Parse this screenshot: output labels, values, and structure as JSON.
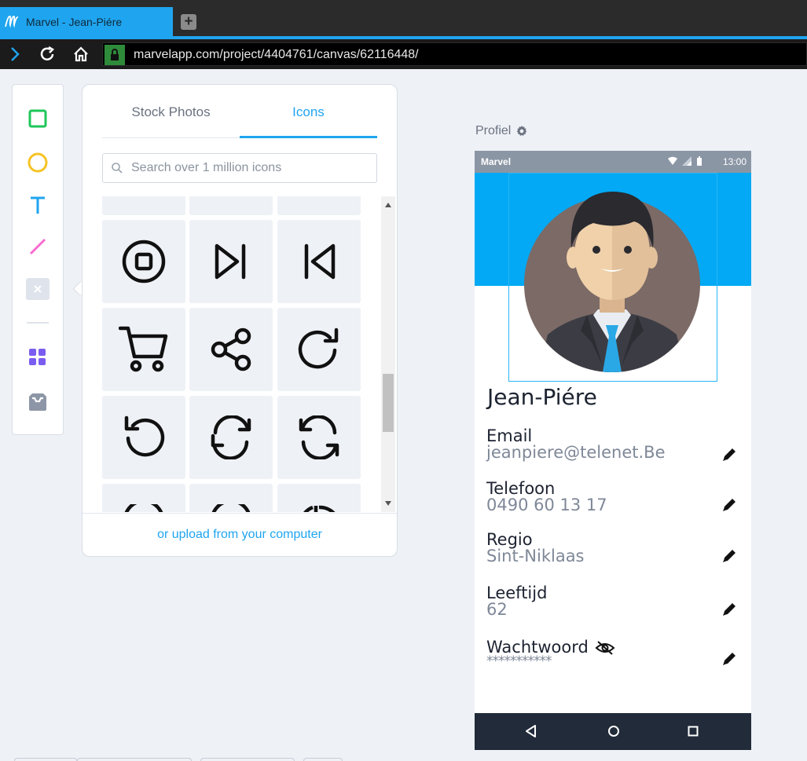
{
  "browser": {
    "tab_title": "Marvel - Jean-Piére",
    "url": "marvelapp.com/project/4404761/canvas/62116448/",
    "new_tab_label": "+"
  },
  "colors": {
    "accent": "#1fa5ef",
    "phone_header": "#03a9f4",
    "phone_nav": "#212b3a"
  },
  "toolbar": {
    "tools": [
      "rectangle-tool",
      "ellipse-tool",
      "text-tool",
      "line-tool",
      "hotspot-tool",
      "components-tool",
      "inbox-tool"
    ]
  },
  "panel": {
    "tabs": [
      {
        "label": "Stock Photos",
        "active": false
      },
      {
        "label": "Icons",
        "active": true
      }
    ],
    "search_placeholder": "Search over 1 million icons",
    "icons": [
      "stop-circle-icon",
      "skip-forward-icon",
      "skip-back-icon",
      "shopping-cart-icon",
      "share-icon",
      "rotate-cw-icon",
      "rotate-ccw-icon",
      "refresh-cw-icon",
      "refresh-ccw-icon"
    ],
    "upload_link": "or upload from your computer"
  },
  "screen": {
    "label": "Profiel",
    "status": {
      "app": "Marvel",
      "time": "13:00"
    },
    "name": "Jean-Piére",
    "fields": [
      {
        "label": "Email",
        "value": "jeanpiere@telenet.Be"
      },
      {
        "label": "Telefoon",
        "value": "0490 60 13 17"
      },
      {
        "label": "Regio",
        "value": "Sint-Niklaas"
      },
      {
        "label": "Leeftijd",
        "value": "62"
      },
      {
        "label": "Wachtwoord",
        "value": "***********"
      }
    ]
  }
}
